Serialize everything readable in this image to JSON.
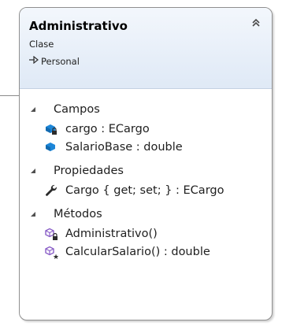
{
  "class": {
    "name": "Administrativo",
    "kind": "Clase",
    "base": "Personal"
  },
  "sections": {
    "fields": {
      "title": "Campos",
      "items": [
        "cargo : ECargo",
        "SalarioBase : double"
      ]
    },
    "properties": {
      "title": "Propiedades",
      "items": [
        "Cargo { get; set; } : ECargo"
      ]
    },
    "methods": {
      "title": "Métodos",
      "items": [
        "Administrativo()",
        "CalcularSalario() : double"
      ]
    }
  },
  "icons": {
    "collapse": "double-chevron-up-icon",
    "base_arrow": "inheritance-arrow-icon",
    "section_toggle": "triangle-expanded-icon",
    "field_private": "field-private-icon",
    "field_public": "field-icon",
    "property": "wrench-property-icon",
    "method_private": "method-private-icon",
    "method_protected": "method-protected-icon"
  },
  "colors": {
    "header_top": "#f3f7fc",
    "header_bottom": "#dfe9f6",
    "border": "#8f8f8f",
    "field_blue": "#1c86d8",
    "method_purple": "#8a5fc7"
  }
}
